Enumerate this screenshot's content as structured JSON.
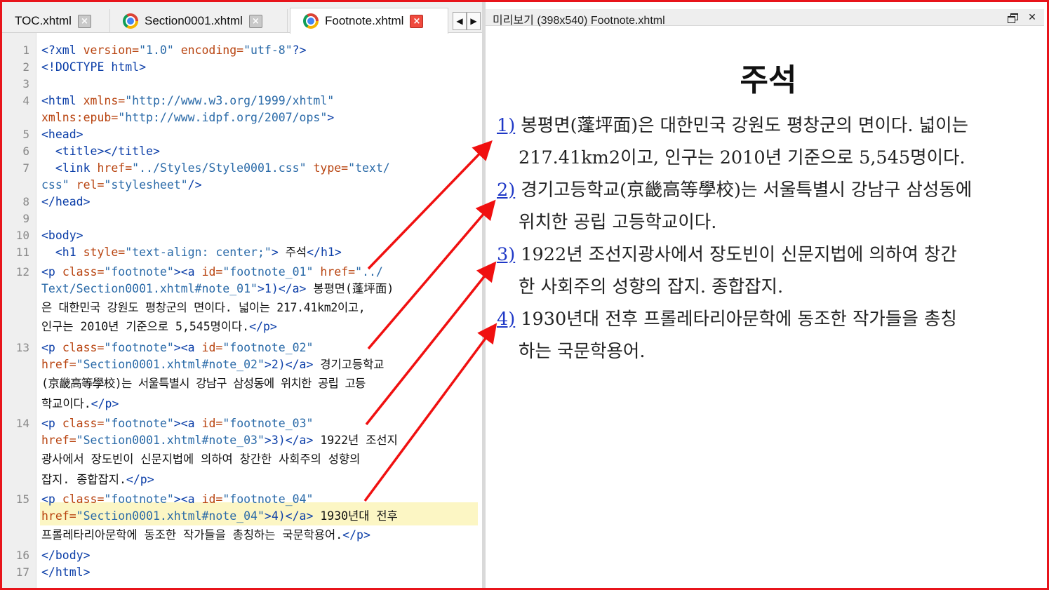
{
  "editor": {
    "tabs": [
      {
        "label": "TOC.xhtml",
        "active": false,
        "icon": "none"
      },
      {
        "label": "Section0001.xhtml",
        "active": false,
        "icon": "chrome-icon"
      },
      {
        "label": "Footnote.xhtml",
        "active": true,
        "icon": "chrome-icon"
      }
    ],
    "tab_close_glyph": "×",
    "scroll_left": "◀",
    "scroll_right": "▶",
    "line_numbers": [
      "1",
      "2",
      "3",
      "4",
      "5",
      "6",
      "7",
      "8",
      "9",
      "10",
      "11",
      "12",
      "13",
      "14",
      "15",
      "16",
      "17"
    ],
    "lines": [
      [
        "<?xml ",
        "version=",
        "\"1.0\"",
        " encoding=",
        "\"utf-8\"",
        "?>"
      ],
      [
        "<!DOCTYPE html>"
      ],
      [],
      [
        "<html ",
        "xmlns=",
        "\"http://www.w3.org/1999/xhtml\""
      ],
      [
        "xmlns:epub=",
        "\"http://www.idpf.org/2007/ops\"",
        ">"
      ],
      [
        "<head>"
      ],
      [
        "  <title></title>"
      ],
      [
        "  <link ",
        "href=",
        "\"../Styles/Style0001.css\"",
        " type=",
        "\"text/"
      ],
      [
        "css\"",
        " rel=",
        "\"stylesheet\"",
        "/>"
      ],
      [
        "</head>"
      ],
      [],
      [
        "<body>"
      ],
      [
        "  <h1 ",
        "style=",
        "\"text-align: center;\"",
        ">",
        " 주석",
        "</h1>"
      ],
      [
        "<p ",
        "class=",
        "\"footnote\"",
        "><a ",
        "id=",
        "\"footnote_01\"",
        " href=",
        "\"../"
      ],
      [
        "Text/Section0001.xhtml#note_01\"",
        ">1)</a>",
        " 봉평면(蓬坪面)"
      ],
      [
        "은 대한민국 강원도 평창군의 면이다. 넓이는 217.41km2이고,"
      ],
      [
        "인구는 2010년 기준으로 5,545명이다.",
        "</p>"
      ],
      [
        "<p ",
        "class=",
        "\"footnote\"",
        "><a ",
        "id=",
        "\"footnote_02\""
      ],
      [
        "href=",
        "\"Section0001.xhtml#note_02\"",
        ">2)</a>",
        " 경기고등학교"
      ],
      [
        "(京畿高等學校)는 서울특별시 강남구 삼성동에 위치한 공립 고등"
      ],
      [
        "학교이다.",
        "</p>"
      ],
      [
        "<p ",
        "class=",
        "\"footnote\"",
        "><a ",
        "id=",
        "\"footnote_03\""
      ],
      [
        "href=",
        "\"Section0001.xhtml#note_03\"",
        ">3)</a>",
        " 1922년 조선지"
      ],
      [
        "광사에서 장도빈이 신문지법에 의하여 창간한 사회주의 성향의"
      ],
      [
        "잡지. 종합잡지.",
        "</p>"
      ],
      [
        "<p ",
        "class=",
        "\"footnote\"",
        "><a ",
        "id=",
        "\"footnote_04\""
      ],
      [
        "href=",
        "\"Section0001.xhtml#note_04\"",
        ">4)</a>",
        " 1930년대 전후"
      ],
      [
        "프롤레타리아문학에 동조한 작가들을 총칭하는 국문학용어.",
        "</p>"
      ],
      [
        "</body>"
      ],
      [
        "</html>"
      ]
    ]
  },
  "preview": {
    "title": "미리보기 (398x540) Footnote.xhtml",
    "restore_icon": "restore-icon",
    "close_glyph": "✕",
    "heading": "주석",
    "footnotes": [
      {
        "num": "1)",
        "line1": " 봉평면(蓬坪面)은 대한민국 강원도 평창군의 면이다. 넓이는",
        "line2": "217.41km2이고, 인구는 2010년 기준으로 5,545명이다."
      },
      {
        "num": "2)",
        "line1": " 경기고등학교(京畿高等學校)는 서울특별시 강남구 삼성동에",
        "line2": "위치한 공립 고등학교이다."
      },
      {
        "num": "3)",
        "line1": " 1922년 조선지광사에서 장도빈이 신문지법에 의하여 창간",
        "line2": "한 사회주의 성향의 잡지. 종합잡지."
      },
      {
        "num": "4)",
        "line1": " 1930년대 전후 프롤레타리아문학에 동조한 작가들을 총칭",
        "line2": "하는 국문학용어."
      }
    ]
  },
  "colors": {
    "frame": "#e8141b",
    "arrow": "#f01010",
    "tag": "#0b3ea8",
    "attr": "#b8430f",
    "value": "#2a6aa8",
    "footnote_link": "#1f38c6",
    "current_line": "#fcf6c4"
  }
}
